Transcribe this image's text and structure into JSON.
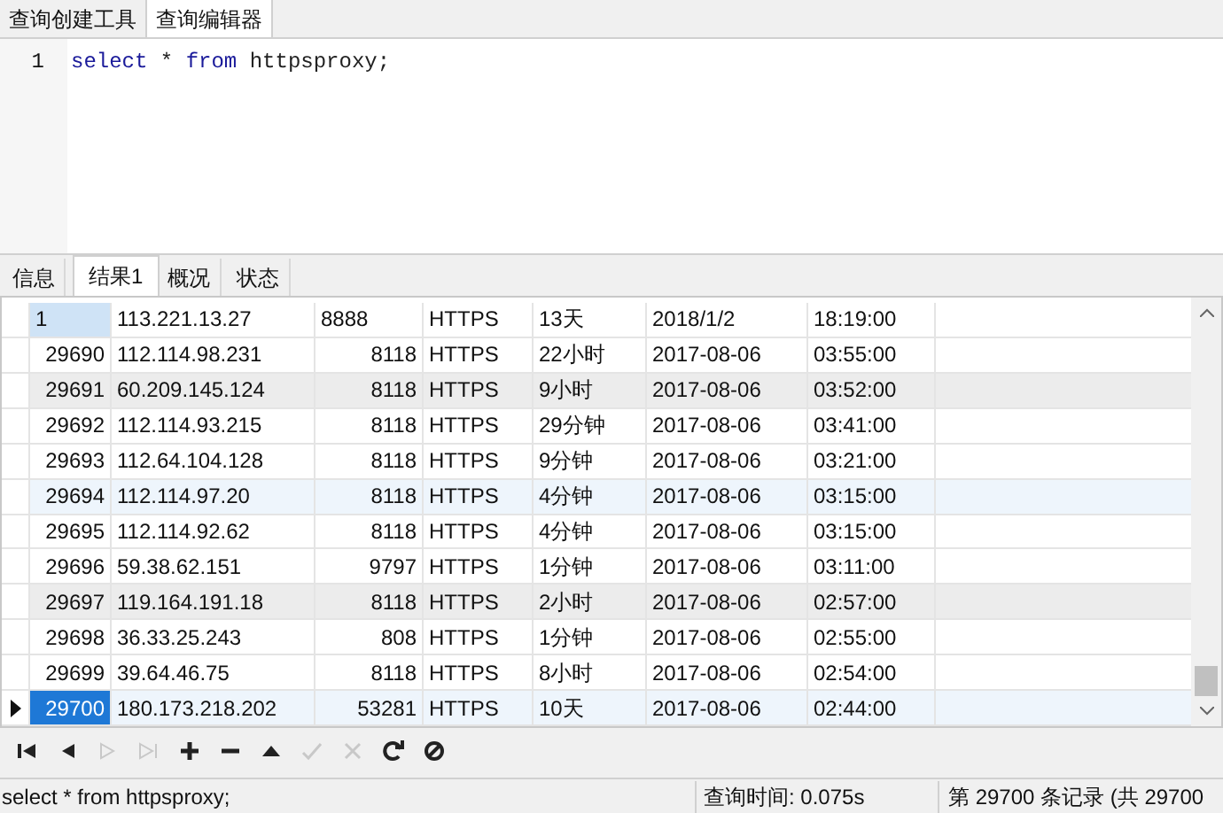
{
  "editor_tabs": [
    {
      "label": "查询创建工具",
      "selected": false
    },
    {
      "label": "查询编辑器",
      "selected": true
    }
  ],
  "editor": {
    "lines": [
      {
        "number": "1",
        "code": [
          {
            "kind": "keyword",
            "text": "select"
          },
          {
            "kind": "plain",
            "text": " * "
          },
          {
            "kind": "keyword",
            "text": "from"
          },
          {
            "kind": "plain",
            "text": " httpsproxy;"
          }
        ]
      }
    ]
  },
  "result_tabs": [
    {
      "label": "信息",
      "selected": false
    },
    {
      "label": "结果1",
      "selected": true
    },
    {
      "label": "概况",
      "selected": false
    },
    {
      "label": "状态",
      "selected": false
    }
  ],
  "table": {
    "rows": [
      {
        "kind": "editing",
        "selected": false,
        "cells": [
          "1",
          "113.221.13.27",
          "8888",
          "HTTPS",
          "13天",
          "2018/1/2",
          "18:19:00"
        ]
      },
      {
        "kind": "plain",
        "selected": false,
        "cells": [
          "29690",
          "112.114.98.231",
          "8118",
          "HTTPS",
          "22小时",
          "2017-08-06",
          "03:55:00"
        ]
      },
      {
        "kind": "grey",
        "selected": false,
        "cells": [
          "29691",
          "60.209.145.124",
          "8118",
          "HTTPS",
          "9小时",
          "2017-08-06",
          "03:52:00"
        ]
      },
      {
        "kind": "plain",
        "selected": false,
        "cells": [
          "29692",
          "112.114.93.215",
          "8118",
          "HTTPS",
          "29分钟",
          "2017-08-06",
          "03:41:00"
        ]
      },
      {
        "kind": "plain",
        "selected": false,
        "cells": [
          "29693",
          "112.64.104.128",
          "8118",
          "HTTPS",
          "9分钟",
          "2017-08-06",
          "03:21:00"
        ]
      },
      {
        "kind": "blue",
        "selected": false,
        "cells": [
          "29694",
          "112.114.97.20",
          "8118",
          "HTTPS",
          "4分钟",
          "2017-08-06",
          "03:15:00"
        ]
      },
      {
        "kind": "plain",
        "selected": false,
        "cells": [
          "29695",
          "112.114.92.62",
          "8118",
          "HTTPS",
          "4分钟",
          "2017-08-06",
          "03:15:00"
        ]
      },
      {
        "kind": "plain",
        "selected": false,
        "cells": [
          "29696",
          "59.38.62.151",
          "9797",
          "HTTPS",
          "1分钟",
          "2017-08-06",
          "03:11:00"
        ]
      },
      {
        "kind": "grey",
        "selected": false,
        "cells": [
          "29697",
          "119.164.191.18",
          "8118",
          "HTTPS",
          "2小时",
          "2017-08-06",
          "02:57:00"
        ]
      },
      {
        "kind": "plain",
        "selected": false,
        "cells": [
          "29698",
          "36.33.25.243",
          "808",
          "HTTPS",
          "1分钟",
          "2017-08-06",
          "02:55:00"
        ]
      },
      {
        "kind": "plain",
        "selected": false,
        "cells": [
          "29699",
          "39.64.46.75",
          "8118",
          "HTTPS",
          "8小时",
          "2017-08-06",
          "02:54:00"
        ]
      },
      {
        "kind": "blue",
        "selected": true,
        "cells": [
          "29700",
          "180.173.218.202",
          "53281",
          "HTTPS",
          "10天",
          "2017-08-06",
          "02:44:00"
        ]
      }
    ]
  },
  "toolbar": [
    {
      "kind": "first",
      "disabled": false
    },
    {
      "kind": "prev",
      "disabled": false
    },
    {
      "kind": "next",
      "disabled": true
    },
    {
      "kind": "last",
      "disabled": true
    },
    {
      "kind": "add",
      "disabled": false
    },
    {
      "kind": "delete",
      "disabled": false
    },
    {
      "kind": "up",
      "disabled": false
    },
    {
      "kind": "apply",
      "disabled": true
    },
    {
      "kind": "cancel",
      "disabled": true
    },
    {
      "kind": "refresh",
      "disabled": false
    },
    {
      "kind": "stop",
      "disabled": false
    }
  ],
  "status_bar": {
    "query": "select * from httpsproxy;",
    "query_time": "查询时间: 0.075s",
    "record": "第 29700 条记录 (共 29700"
  }
}
